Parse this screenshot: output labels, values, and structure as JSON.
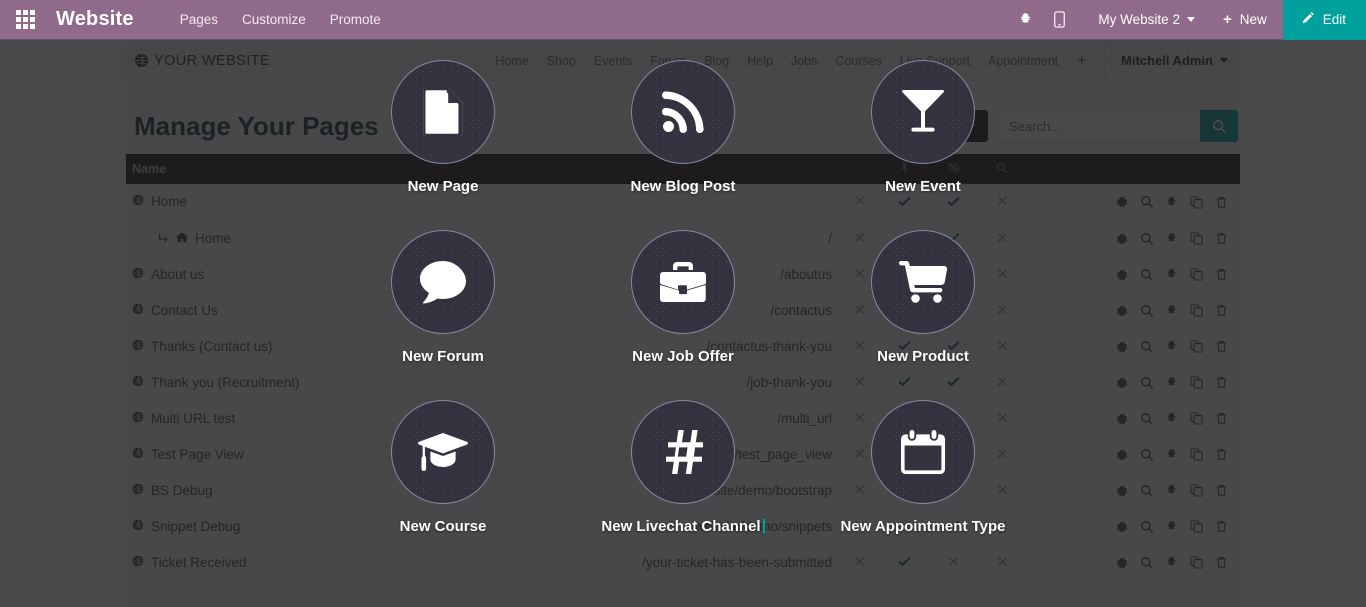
{
  "topbar": {
    "apps_icon": "apps-grid-icon",
    "brand": "Website",
    "menu": [
      {
        "label": "Pages"
      },
      {
        "label": "Customize"
      },
      {
        "label": "Promote"
      }
    ],
    "systray": [
      {
        "name": "debug-bug-icon"
      },
      {
        "name": "mobile-preview-icon"
      }
    ],
    "website_selector": "My Website 2",
    "new_label": "New",
    "edit_label": "Edit",
    "accent_color": "#00a09d",
    "bar_color": "#8f6a8a"
  },
  "site": {
    "logo_text": "YOUR WEBSITE",
    "nav": [
      {
        "label": "Home"
      },
      {
        "label": "Shop"
      },
      {
        "label": "Events"
      },
      {
        "label": "Forum"
      },
      {
        "label": "Blog"
      },
      {
        "label": "Help"
      },
      {
        "label": "Jobs"
      },
      {
        "label": "Courses"
      },
      {
        "label": "Live Support"
      },
      {
        "label": "Appointment"
      }
    ],
    "nav_add": "+",
    "user": "Mitchell Admin"
  },
  "main": {
    "title": "Manage Your Pages",
    "filter_label": "",
    "search": {
      "placeholder": "Search...",
      "value": "",
      "button_icon": "search-icon"
    },
    "table": {
      "columns": [
        {
          "key": "name",
          "label": "Name"
        },
        {
          "key": "url",
          "label": ""
        },
        {
          "key": "published",
          "label": ""
        },
        {
          "key": "pin",
          "label": "",
          "icon": "pin-icon"
        },
        {
          "key": "visible",
          "label": "",
          "icon": "eye-slash-icon"
        },
        {
          "key": "indexed",
          "label": "",
          "icon": "search-icon"
        },
        {
          "key": "actions",
          "label": ""
        }
      ],
      "rows": [
        {
          "name": "Home",
          "sub": false,
          "url": "",
          "c1": "x",
          "c2": "check",
          "c3": "check",
          "c4": "x"
        },
        {
          "name": "Home",
          "sub": true,
          "url": "/",
          "c1": "x",
          "c2": "check",
          "c3": "check",
          "c4": "x"
        },
        {
          "name": "About us",
          "sub": false,
          "url": "/aboutus",
          "c1": "x",
          "c2": "check",
          "c3": "check",
          "c4": "x"
        },
        {
          "name": "Contact Us",
          "sub": false,
          "url": "/contactus",
          "c1": "x",
          "c2": "check",
          "c3": "check",
          "c4": "x"
        },
        {
          "name": "Thanks (Contact us)",
          "sub": false,
          "url": "/contactus-thank-you",
          "c1": "x",
          "c2": "check",
          "c3": "check",
          "c4": "x"
        },
        {
          "name": "Thank you (Recruitment)",
          "sub": false,
          "url": "/job-thank-you",
          "c1": "x",
          "c2": "check",
          "c3": "check",
          "c4": "x"
        },
        {
          "name": "Multi URL test",
          "sub": false,
          "url": "/multi_url",
          "c1": "x",
          "c2": "check",
          "c3": "check",
          "c4": "x"
        },
        {
          "name": "Test Page View",
          "sub": false,
          "url": "/test_page_view",
          "c1": "x",
          "c2": "check",
          "c3": "check",
          "c4": "x"
        },
        {
          "name": "BS Debug",
          "sub": false,
          "url": "/website/demo/bootstrap",
          "c1": "x",
          "c2": "check",
          "c3": "check",
          "c4": "x"
        },
        {
          "name": "Snippet Debug",
          "sub": false,
          "url": "/website/demo/snippets",
          "c1": "x",
          "c2": "x",
          "c3": "check",
          "c4": "x"
        },
        {
          "name": "Ticket Received",
          "sub": false,
          "url": "/your-ticket-has-been-submitted",
          "c1": "x",
          "c2": "check",
          "c3": "x",
          "c4": "x"
        }
      ],
      "row_actions": [
        {
          "name": "settings-gear-icon"
        },
        {
          "name": "search-icon"
        },
        {
          "name": "debug-bug-icon"
        },
        {
          "name": "duplicate-copy-icon"
        },
        {
          "name": "delete-trash-icon"
        }
      ]
    }
  },
  "new_content": {
    "items": [
      {
        "label": "New Page",
        "icon": "file-icon"
      },
      {
        "label": "New Blog Post",
        "icon": "rss-icon"
      },
      {
        "label": "New Event",
        "icon": "martini-glass-icon"
      },
      {
        "label": "New Forum",
        "icon": "comment-bubble-icon"
      },
      {
        "label": "New Job Offer",
        "icon": "briefcase-icon"
      },
      {
        "label": "New Product",
        "icon": "shopping-cart-icon"
      },
      {
        "label": "New Course",
        "icon": "graduation-cap-icon"
      },
      {
        "label": "New Livechat Channel",
        "icon": "hashtag-icon"
      },
      {
        "label": "New Appointment Type",
        "icon": "calendar-icon"
      }
    ],
    "overlay_color": "#1c1c1e"
  }
}
